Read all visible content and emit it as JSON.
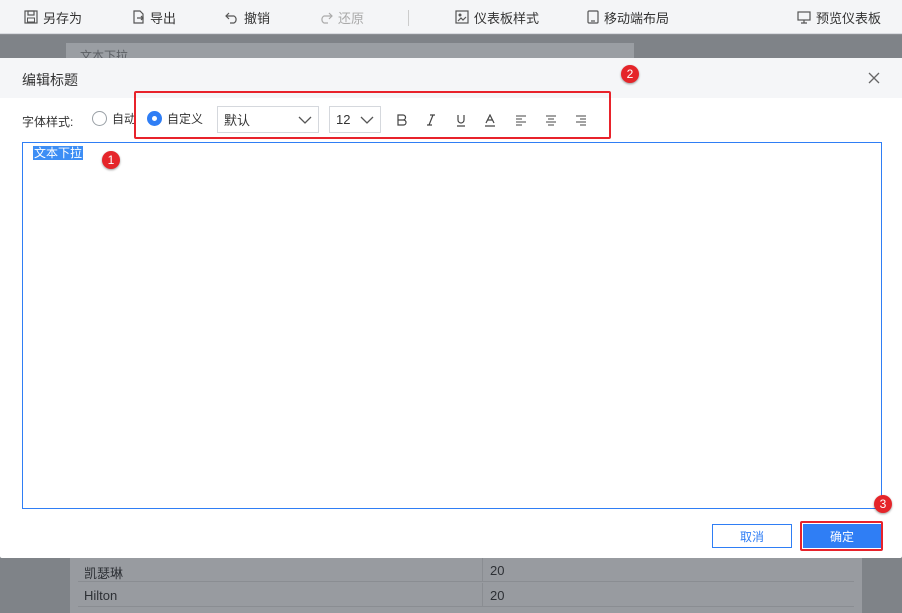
{
  "toolbar": {
    "save_as": "另存为",
    "export": "导出",
    "undo": "撤销",
    "redo": "还原",
    "dashboard_style": "仪表板样式",
    "mobile_layout": "移动端布局",
    "preview": "预览仪表板"
  },
  "background": {
    "panel_title": "文本下拉",
    "rows": [
      {
        "name": "凯瑟琳",
        "value": "20"
      },
      {
        "name": "Hilton",
        "value": "20"
      }
    ]
  },
  "dialog": {
    "title": "编辑标题",
    "font_style_label": "字体样式:",
    "radio_auto": "自动",
    "radio_custom": "自定义",
    "font_family": "默认",
    "font_size": "12",
    "editor_text": "文本下拉",
    "cancel": "取消",
    "ok": "确定"
  },
  "annotations": {
    "badge1": "1",
    "badge2": "2",
    "badge3": "3"
  },
  "colors": {
    "accent": "#2f7ef5",
    "annotation": "#e5252a"
  }
}
